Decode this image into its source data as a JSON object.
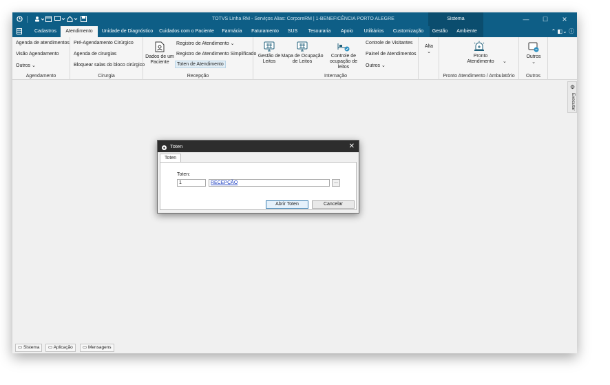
{
  "titlebar": {
    "title": "TOTVS Linha RM - Serviços  Alias: CorporeRM | 1-BENEFICÊNCIA PORTO ALEGRE",
    "context_tab": "Sistema"
  },
  "menu": {
    "tabs": [
      "Cadastros",
      "Atendimento",
      "Unidade de Diagnóstico",
      "Cuidados com o Paciente",
      "Farmácia",
      "Faturamento",
      "SUS",
      "Tesouraria",
      "Apoio",
      "Utilitários",
      "Customização",
      "Gestão",
      "Ambiente"
    ],
    "active_tab": "Atendimento"
  },
  "ribbon": {
    "agendamento": {
      "items": [
        "Agenda de atendimentos",
        "Visão Agendamento",
        "Outros"
      ],
      "label": "Agendamento"
    },
    "cirurgia": {
      "items": [
        "Pré-Agendamento Cirúrgico",
        "Agenda de cirurgias",
        "Bloquear salas do bloco cirúrgico"
      ],
      "label": "Cirurgia"
    },
    "recepcao": {
      "big_button": "Dados de um Paciente",
      "items": [
        "Registro de Atendimento",
        "Registro de Atendimento Simplificado",
        "Toten de Atendimento"
      ],
      "label": "Recepção"
    },
    "internacao": {
      "gestao_leitos": "Gestão de Leitos",
      "mapa_ocupacao": "Mapa de Ocupação de Leitos",
      "controle_ocupacao": "Controle de ocupação de leitos",
      "items": [
        "Controle de Visitantes",
        "Painel de Atendimentos",
        "Outros"
      ],
      "label": "Internação"
    },
    "alta": {
      "label": "Alta"
    },
    "pronto": {
      "big_button": "Pronto Atendimento",
      "label": "Pronto Atendimento / Ambulatório"
    },
    "outros": {
      "big_button": "Outros",
      "label": "Outros"
    }
  },
  "side_panel": {
    "executar": "Executar"
  },
  "statusbar": {
    "buttons": [
      "Sistema",
      "Aplicação",
      "Mensagens"
    ]
  },
  "dialog": {
    "title": "Toten",
    "tab": "Toten",
    "field_label": "Toten:",
    "code_value": "1",
    "description_value": "RECEPÇÃO",
    "lookup_label": "...",
    "ok_label": "Abrir Toten",
    "cancel_label": "Cancelar"
  },
  "colors": {
    "titlebar": "#0e5e86",
    "context_tab": "#0b4d6e",
    "dialog_title": "#2d2d2d",
    "link": "#1a3dc1"
  }
}
